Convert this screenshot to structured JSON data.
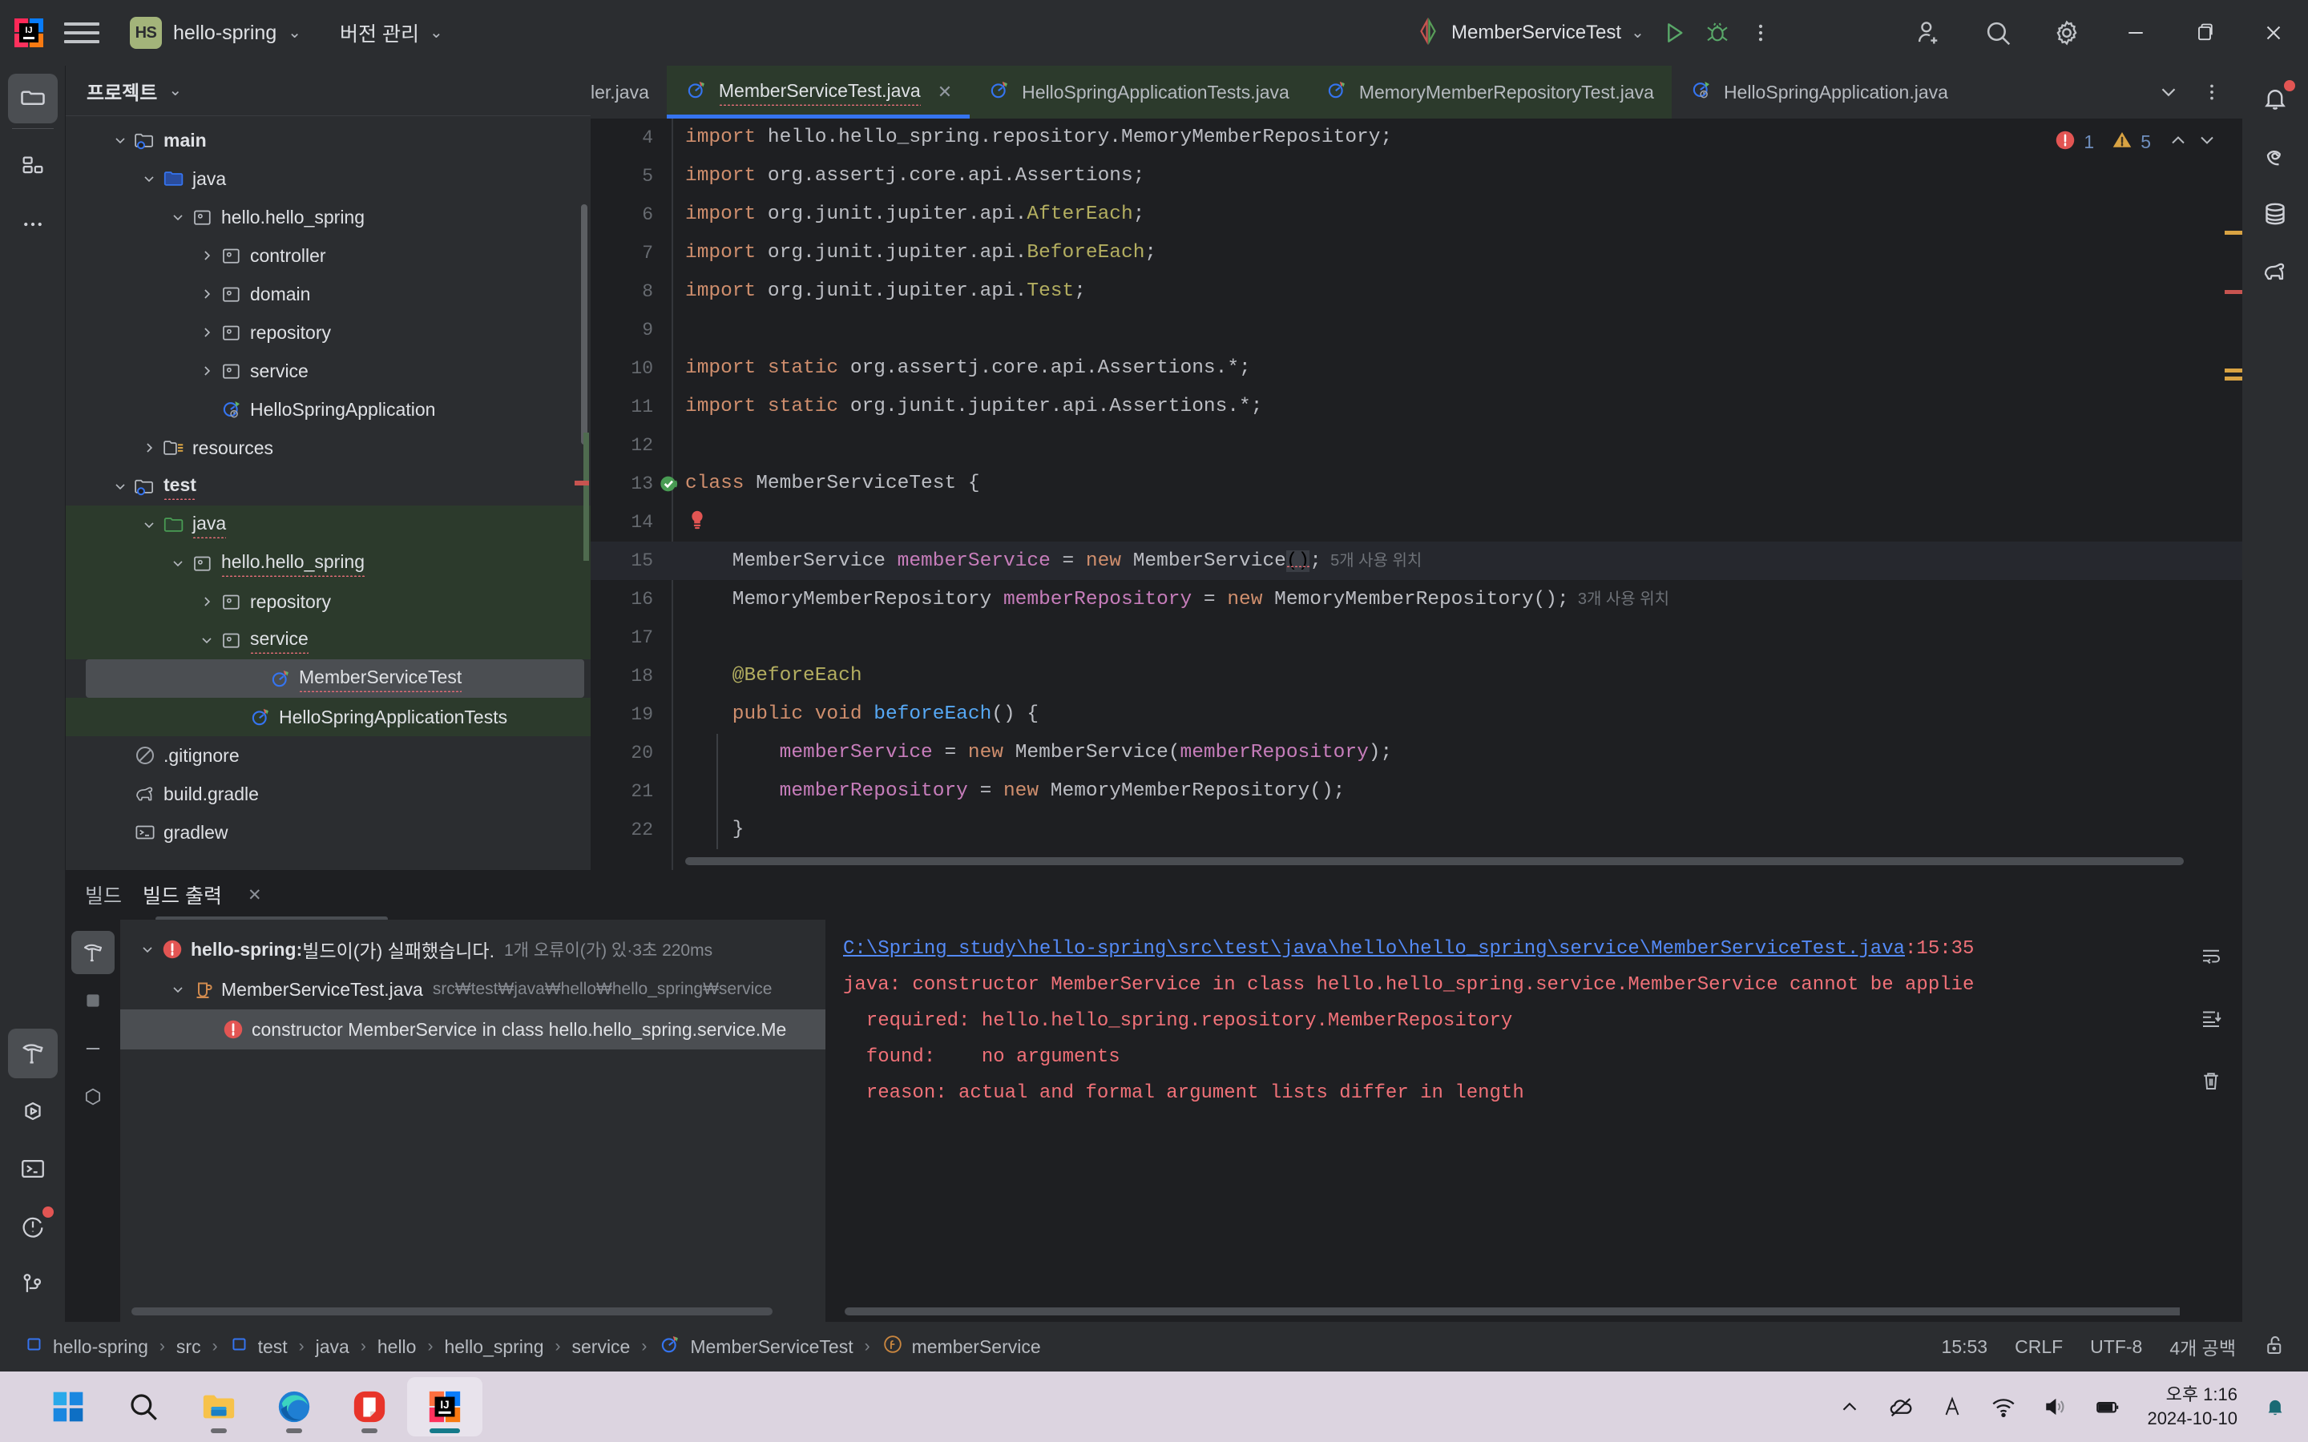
{
  "titlebar": {
    "menu_icon": "hamburger-icon",
    "project_badge": "HS",
    "project_name": "hello-spring",
    "vcs_label": "버전 관리",
    "run_config": "MemberServiceTest",
    "run_icon": "run-icon",
    "debug_icon": "debug-icon",
    "more_icon": "more-vertical-icon",
    "account_icon": "add-user-icon",
    "search_icon": "search-icon",
    "settings_icon": "gear-icon",
    "minimize": "minimize-icon",
    "maximize": "restore-icon",
    "close": "close-icon"
  },
  "left_rail": {
    "top_items": [
      {
        "name": "project-tool-window",
        "icon": "folder-icon",
        "active": true
      },
      {
        "name": "structure-tool-window",
        "icon": "structure-icon",
        "active": false
      },
      {
        "name": "more-tool-windows",
        "icon": "ellipsis-icon",
        "active": false
      }
    ],
    "bottom_items": [
      {
        "name": "build-tool-window",
        "icon": "hammer-icon",
        "active": true
      },
      {
        "name": "run-tool-window",
        "icon": "run-hex-icon",
        "active": false
      },
      {
        "name": "terminal-tool-window",
        "icon": "terminal-icon",
        "active": false
      },
      {
        "name": "problems-tool-window",
        "icon": "problems-icon",
        "active": false,
        "badge": true
      },
      {
        "name": "version-control-tool-window",
        "icon": "branch-icon",
        "active": false
      }
    ]
  },
  "right_rail": {
    "items": [
      {
        "name": "notifications",
        "icon": "bell-icon",
        "badge": true
      },
      {
        "name": "ai-assistant",
        "icon": "spiral-icon",
        "badge": false
      },
      {
        "name": "database",
        "icon": "database-icon",
        "badge": false
      },
      {
        "name": "gradle",
        "icon": "elephant-icon",
        "badge": false
      }
    ]
  },
  "project_panel": {
    "title": "프로젝트",
    "tree": [
      {
        "label": "main",
        "depth": 2,
        "arrow": "down",
        "icon": "module-folder-icon",
        "bold": true,
        "state": "normal",
        "squiggle": false
      },
      {
        "label": "java",
        "depth": 3,
        "arrow": "down",
        "icon": "source-folder-blue-icon",
        "bold": false,
        "state": "normal",
        "squiggle": false
      },
      {
        "label": "hello.hello_spring",
        "depth": 4,
        "arrow": "down",
        "icon": "package-icon",
        "bold": false,
        "state": "normal",
        "squiggle": false
      },
      {
        "label": "controller",
        "depth": 5,
        "arrow": "right",
        "icon": "package-icon",
        "bold": false,
        "state": "normal",
        "squiggle": false
      },
      {
        "label": "domain",
        "depth": 5,
        "arrow": "right",
        "icon": "package-icon",
        "bold": false,
        "state": "normal",
        "squiggle": false
      },
      {
        "label": "repository",
        "depth": 5,
        "arrow": "right",
        "icon": "package-icon",
        "bold": false,
        "state": "normal",
        "squiggle": false
      },
      {
        "label": "service",
        "depth": 5,
        "arrow": "right",
        "icon": "package-icon",
        "bold": false,
        "state": "normal",
        "squiggle": false
      },
      {
        "label": "HelloSpringApplication",
        "depth": 5,
        "arrow": "none",
        "icon": "spring-class-icon",
        "bold": false,
        "state": "normal",
        "squiggle": false
      },
      {
        "label": "resources",
        "depth": 3,
        "arrow": "right",
        "icon": "resources-folder-icon",
        "bold": false,
        "state": "normal",
        "squiggle": false
      },
      {
        "label": "test",
        "depth": 2,
        "arrow": "down",
        "icon": "module-folder-icon",
        "bold": true,
        "state": "normal",
        "squiggle": true
      },
      {
        "label": "java",
        "depth": 3,
        "arrow": "down",
        "icon": "test-folder-green-icon",
        "bold": false,
        "state": "green",
        "squiggle": true
      },
      {
        "label": "hello.hello_spring",
        "depth": 4,
        "arrow": "down",
        "icon": "package-icon",
        "bold": false,
        "state": "green",
        "squiggle": true
      },
      {
        "label": "repository",
        "depth": 5,
        "arrow": "right",
        "icon": "package-icon",
        "bold": false,
        "state": "green",
        "squiggle": false
      },
      {
        "label": "service",
        "depth": 5,
        "arrow": "down",
        "icon": "package-icon",
        "bold": false,
        "state": "green",
        "squiggle": true
      },
      {
        "label": "MemberServiceTest",
        "depth": 6,
        "arrow": "none",
        "icon": "test-class-icon",
        "bold": false,
        "state": "selected",
        "squiggle": true
      },
      {
        "label": "HelloSpringApplicationTests",
        "depth": 6,
        "arrow": "none",
        "icon": "test-class-icon",
        "bold": false,
        "state": "green",
        "squiggle": false
      },
      {
        "label": ".gitignore",
        "depth": 2,
        "arrow": "none",
        "icon": "gitignore-icon",
        "bold": false,
        "state": "normal",
        "squiggle": false
      },
      {
        "label": "build.gradle",
        "depth": 2,
        "arrow": "none",
        "icon": "gradle-elephant-icon",
        "bold": false,
        "state": "normal",
        "squiggle": false
      },
      {
        "label": "gradlew",
        "depth": 2,
        "arrow": "none",
        "icon": "script-icon",
        "bold": false,
        "state": "normal",
        "squiggle": false
      }
    ]
  },
  "editor": {
    "tabs": [
      {
        "label": "ler.java",
        "icon": "none",
        "active": false,
        "partial": true,
        "green": false,
        "close": false
      },
      {
        "label": "MemberServiceTest.java",
        "icon": "test-class-icon",
        "active": true,
        "partial": false,
        "green": true,
        "close": true,
        "squiggle": true
      },
      {
        "label": "HelloSpringApplicationTests.java",
        "icon": "test-class-icon",
        "active": false,
        "partial": false,
        "green": true,
        "close": false
      },
      {
        "label": "MemoryMemberRepositoryTest.java",
        "icon": "test-class-icon",
        "active": false,
        "partial": false,
        "green": true,
        "close": false
      },
      {
        "label": "HelloSpringApplication.java",
        "icon": "spring-class-icon",
        "active": false,
        "partial": false,
        "green": false,
        "close": false
      }
    ],
    "tab_overflow_icon": "chevron-down-icon",
    "tab_options_icon": "more-vertical-icon",
    "inspections": {
      "error_icon": "error-icon",
      "error_count": "1",
      "warning_icon": "warning-icon",
      "warning_count": "5",
      "prev_icon": "chevron-up-icon",
      "next_icon": "chevron-down-icon"
    },
    "lines": [
      {
        "n": "4",
        "segments": [
          {
            "t": "import ",
            "c": "kw"
          },
          {
            "t": "hello.hello_spring.repository.MemoryMemberRepository;",
            "c": "plain"
          }
        ]
      },
      {
        "n": "5",
        "segments": [
          {
            "t": "import ",
            "c": "kw"
          },
          {
            "t": "org.assertj.core.api.Assertions;",
            "c": "plain"
          }
        ]
      },
      {
        "n": "6",
        "segments": [
          {
            "t": "import ",
            "c": "kw"
          },
          {
            "t": "org.junit.jupiter.api.",
            "c": "plain"
          },
          {
            "t": "AfterEach",
            "c": "ann"
          },
          {
            "t": ";",
            "c": "plain"
          }
        ]
      },
      {
        "n": "7",
        "segments": [
          {
            "t": "import ",
            "c": "kw"
          },
          {
            "t": "org.junit.jupiter.api.",
            "c": "plain"
          },
          {
            "t": "BeforeEach",
            "c": "ann"
          },
          {
            "t": ";",
            "c": "plain"
          }
        ]
      },
      {
        "n": "8",
        "segments": [
          {
            "t": "import ",
            "c": "kw"
          },
          {
            "t": "org.junit.jupiter.api.",
            "c": "plain"
          },
          {
            "t": "Test",
            "c": "ann"
          },
          {
            "t": ";",
            "c": "plain"
          }
        ]
      },
      {
        "n": "9",
        "segments": []
      },
      {
        "n": "10",
        "segments": [
          {
            "t": "import static ",
            "c": "kw"
          },
          {
            "t": "org.assertj.core.api.Assertions.*;",
            "c": "plain"
          }
        ]
      },
      {
        "n": "11",
        "segments": [
          {
            "t": "import static ",
            "c": "kw"
          },
          {
            "t": "org.junit.jupiter.api.Assertions.*;",
            "c": "plain"
          }
        ]
      },
      {
        "n": "12",
        "segments": []
      },
      {
        "n": "13",
        "segments": [
          {
            "t": "class ",
            "c": "kw"
          },
          {
            "t": "MemberServiceTest {",
            "c": "plain"
          }
        ],
        "gutter": "run-test-icon"
      },
      {
        "n": "14",
        "segments": [],
        "gutter": "error-bulb-icon"
      },
      {
        "n": "15",
        "segments": [
          {
            "t": "    MemberService ",
            "c": "plain"
          },
          {
            "t": "memberService",
            "c": "fld"
          },
          {
            "t": " = ",
            "c": "plain"
          },
          {
            "t": "new ",
            "c": "kw"
          },
          {
            "t": "MemberService",
            "c": "plain"
          },
          {
            "t": "()",
            "c": "parenhl"
          },
          {
            "t": ";",
            "c": "plain"
          },
          {
            "t": "  5개 사용 위치",
            "c": "hint"
          }
        ],
        "highlight": true
      },
      {
        "n": "16",
        "segments": [
          {
            "t": "    MemoryMemberRepository ",
            "c": "plain"
          },
          {
            "t": "memberRepository",
            "c": "fld"
          },
          {
            "t": " = ",
            "c": "plain"
          },
          {
            "t": "new ",
            "c": "kw"
          },
          {
            "t": "MemoryMemberRepository();",
            "c": "plain"
          },
          {
            "t": "  3개 사용 위치",
            "c": "hint"
          }
        ]
      },
      {
        "n": "17",
        "segments": []
      },
      {
        "n": "18",
        "segments": [
          {
            "t": "    @BeforeEach",
            "c": "ann"
          }
        ]
      },
      {
        "n": "19",
        "segments": [
          {
            "t": "    public void ",
            "c": "kw"
          },
          {
            "t": "beforeEach",
            "c": "mtd"
          },
          {
            "t": "() {",
            "c": "plain"
          }
        ]
      },
      {
        "n": "20",
        "segments": [
          {
            "t": "        ",
            "c": "plain"
          },
          {
            "t": "memberService",
            "c": "fld"
          },
          {
            "t": " = ",
            "c": "plain"
          },
          {
            "t": "new ",
            "c": "kw"
          },
          {
            "t": "MemberService(",
            "c": "plain"
          },
          {
            "t": "memberRepository",
            "c": "fld"
          },
          {
            "t": ");",
            "c": "plain"
          }
        ]
      },
      {
        "n": "21",
        "segments": [
          {
            "t": "        ",
            "c": "plain"
          },
          {
            "t": "memberRepository",
            "c": "fld"
          },
          {
            "t": " = ",
            "c": "plain"
          },
          {
            "t": "new ",
            "c": "kw"
          },
          {
            "t": "MemoryMemberRepository();",
            "c": "plain"
          }
        ]
      },
      {
        "n": "22",
        "segments": [
          {
            "t": "    }",
            "c": "plain"
          }
        ]
      }
    ]
  },
  "build_panel": {
    "tabs": [
      {
        "label": "빌드",
        "active": false,
        "close": false
      },
      {
        "label": "빌드 출력",
        "active": true,
        "close": true
      }
    ],
    "close_icon": "close-icon",
    "rail": [
      {
        "name": "build-filter",
        "icon": "hammer-icon",
        "active": true
      },
      {
        "name": "stop-build",
        "icon": "stop-icon",
        "active": false
      },
      {
        "name": "minimize-build",
        "icon": "minus-icon",
        "active": false
      },
      {
        "name": "settings-build",
        "icon": "gear-icon",
        "active": false
      }
    ],
    "tree": [
      {
        "label": "hello-spring:",
        "suffix": " 빌드이(가) 실패했습니다.",
        "meta": "1개 오류이(가) 있·3초 220ms",
        "depth": 1,
        "arrow": "down",
        "icon": "error-icon",
        "bold": true,
        "selected": false
      },
      {
        "label": "MemberServiceTest.java",
        "suffix": "",
        "meta": "src₩test₩java₩hello₩hello_spring₩service",
        "depth": 2,
        "arrow": "down",
        "icon": "java-file-icon",
        "bold": false,
        "selected": false
      },
      {
        "label": "constructor MemberService in class hello.hello_spring.service.Me",
        "suffix": "",
        "meta": "",
        "depth": 3,
        "arrow": "none",
        "icon": "error-icon",
        "bold": false,
        "selected": true
      }
    ],
    "output": [
      {
        "link": "C:\\Spring study\\hello-spring\\src\\test\\java\\hello\\hello_spring\\service\\MemberServiceTest.java",
        "pos": ":15:35",
        "type": "link"
      },
      {
        "text": "java: constructor MemberService in class hello.hello_spring.service.MemberService cannot be applie",
        "type": "error"
      },
      {
        "text": "  required: hello.hello_spring.repository.MemberRepository",
        "type": "error"
      },
      {
        "text": "  found:    no arguments",
        "type": "error"
      },
      {
        "text": "  reason: actual and formal argument lists differ in length",
        "type": "error"
      }
    ],
    "out_rail": [
      {
        "name": "soft-wrap",
        "icon": "wrap-icon"
      },
      {
        "name": "scroll-to-end",
        "icon": "scroll-end-icon"
      },
      {
        "name": "clear-output",
        "icon": "trash-icon"
      }
    ]
  },
  "status_bar": {
    "breadcrumbs": [
      {
        "label": "hello-spring",
        "icon": "module-icon"
      },
      {
        "label": "src",
        "icon": "none"
      },
      {
        "label": "test",
        "icon": "module-icon"
      },
      {
        "label": "java",
        "icon": "none"
      },
      {
        "label": "hello",
        "icon": "none"
      },
      {
        "label": "hello_spring",
        "icon": "none"
      },
      {
        "label": "service",
        "icon": "none"
      },
      {
        "label": "MemberServiceTest",
        "icon": "test-class-icon"
      },
      {
        "label": "memberService",
        "icon": "field-icon"
      }
    ],
    "caret_position": "15:53",
    "line_separator": "CRLF",
    "encoding": "UTF-8",
    "indent": "4개 공백",
    "lock_icon": "unlocked-icon"
  },
  "taskbar": {
    "apps": [
      {
        "name": "start-button",
        "icon": "windows-logo-icon",
        "open": false,
        "running": false
      },
      {
        "name": "taskbar-search",
        "icon": "search-icon",
        "open": false,
        "running": false
      },
      {
        "name": "file-explorer",
        "icon": "folder-icon",
        "open": false,
        "running": true
      },
      {
        "name": "microsoft-edge",
        "icon": "edge-icon",
        "open": false,
        "running": true
      },
      {
        "name": "red-app",
        "icon": "red-app-icon",
        "open": false,
        "running": true
      },
      {
        "name": "intellij-idea",
        "icon": "intellij-icon",
        "open": true,
        "running": true
      }
    ],
    "tray": [
      {
        "name": "show-hidden-icons",
        "icon": "chevron-up-icon"
      },
      {
        "name": "onedrive-paused",
        "icon": "cloud-off-icon"
      },
      {
        "name": "input-method",
        "icon": "korean-ime-icon"
      },
      {
        "name": "wifi",
        "icon": "wifi-icon"
      },
      {
        "name": "volume",
        "icon": "speaker-icon"
      },
      {
        "name": "battery",
        "icon": "battery-icon"
      }
    ],
    "clock_time": "오후 1:16",
    "clock_date": "2024-10-10",
    "notification_icon": "bell-icon"
  },
  "colors": {
    "accent_blue": "#3574f0",
    "error_red": "#c75450",
    "warning_yellow": "#d9a343",
    "test_green": "#2c3a2c",
    "panel_bg": "#2b2d30",
    "editor_bg": "#1e1f22"
  }
}
